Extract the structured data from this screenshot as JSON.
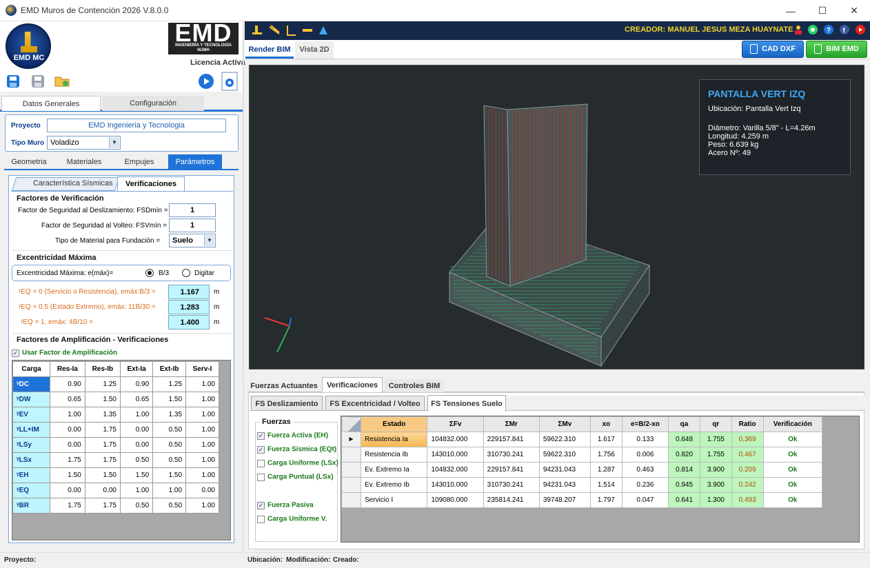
{
  "window": {
    "title": "EMD Muros de Contención 2026 V.8.0.0",
    "minimize": "—",
    "maximize": "☐",
    "close": "✕"
  },
  "logo": {
    "label": "EMD MC",
    "brand": "EMD",
    "brand_sub1": "INGENIERÍA Y TECNOLOGÍA",
    "brand_sub2": "MJMH",
    "licencia": "Licencia Activa"
  },
  "toolbar_left": {
    "icons": [
      "save-as-icon",
      "save-icon",
      "open-folder-icon",
      "play-icon",
      "preview-icon"
    ]
  },
  "main_tabs": [
    {
      "label": "Datos Generales"
    },
    {
      "label": "Configuración"
    }
  ],
  "proyecto": {
    "label": "Proyecto",
    "value": "EMD Ingenieria y Tecnologia"
  },
  "tipo_muro": {
    "label": "Tipo Muro",
    "value": "Voladizo"
  },
  "sub_tabs": [
    {
      "label": "Geometria"
    },
    {
      "label": "Materiales"
    },
    {
      "label": "Empujes"
    },
    {
      "label": "Parámetros"
    }
  ],
  "param_tabs": [
    {
      "label": "Característica Sísmicas"
    },
    {
      "label": "Verificaciones"
    }
  ],
  "factores": {
    "title": "Factores de Verificación",
    "fsd_label": "Factor de Seguridad al Deslizamiento:  FSDmín =",
    "fsd_value": "1",
    "fsv_label": "Factor de Seguridad al Volteo:  FSVmín =",
    "fsv_value": "1",
    "mat_label": "Tipo de Material para  Fundación    =",
    "mat_value": "Suelo"
  },
  "excentricidad": {
    "title": "Excentricidad Máxima",
    "label": "Excentricidad Máxima: e(máx)=",
    "opt1": "B/3",
    "opt2": "Digitar",
    "rows": [
      {
        "label": "ᵞEQ = 0 (Servicio o Resistencia), emáx:B/3 =",
        "value": "1.167",
        "unit": "m"
      },
      {
        "label": "ᵞEQ = 0.5 (Estado Extremo), emáx: 11B/30 =",
        "value": "1.283",
        "unit": "m"
      },
      {
        "label": "ᵞEQ = 1, emáx: 4B/10 =",
        "value": "1.400",
        "unit": "m"
      }
    ]
  },
  "amplificacion": {
    "title": "Factores de Amplificación - Verificaciones",
    "checkbox": "Usar Factor de Amplificación",
    "headers": [
      "Carga",
      "Res-Ia",
      "Res-Ib",
      "Ext-Ia",
      "Ext-Ib",
      "Serv-I"
    ],
    "rows": [
      [
        "ᵞDC",
        "0.90",
        "1.25",
        "0.90",
        "1.25",
        "1.00"
      ],
      [
        "ᵞDW",
        "0.65",
        "1.50",
        "0.65",
        "1.50",
        "1.00"
      ],
      [
        "ᵞEV",
        "1.00",
        "1.35",
        "1.00",
        "1.35",
        "1.00"
      ],
      [
        "ᵞLL+IM",
        "0.00",
        "1.75",
        "0.00",
        "0.50",
        "1.00"
      ],
      [
        "ᵞLSy",
        "0.00",
        "1.75",
        "0.00",
        "0.50",
        "1.00"
      ],
      [
        "ᵞLSx",
        "1.75",
        "1.75",
        "0.50",
        "0.50",
        "1.00"
      ],
      [
        "ᵞEH",
        "1.50",
        "1.50",
        "1.50",
        "1.50",
        "1.00"
      ],
      [
        "ᵞEQ",
        "0.00",
        "0.00",
        "1.00",
        "1.00",
        "0.00"
      ],
      [
        "ᵞBR",
        "1.75",
        "1.75",
        "0.50",
        "0.50",
        "1.00"
      ]
    ]
  },
  "creador": "CREADOR: MANUEL JESUS MEZA HUAYNATE",
  "view_tabs": [
    {
      "label": "Render BIM"
    },
    {
      "label": "Vista 2D"
    }
  ],
  "buttons": {
    "cad": "CAD DXF",
    "bim": "BIM EMD"
  },
  "info_panel": {
    "title": "PANTALLA VERT IZQ",
    "ubicacion": "Ubicación: Pantalla Vert Izq",
    "diametro": "Diámetro: Varilla 5/8\" - L=4.26m",
    "longitud": "Longitud: 4.259 m",
    "peso": "Peso: 6.639 kg",
    "acero": "Acero Nº: 49"
  },
  "result_tabs": [
    {
      "label": "Fuerzas Actuantes"
    },
    {
      "label": "Verificaciones"
    },
    {
      "label": "Controles BIM"
    }
  ],
  "check_tabs": [
    {
      "label": "FS Deslizamiento"
    },
    {
      "label": "FS Excentricidad / Volteo"
    },
    {
      "label": "FS Tensiones Suelo"
    }
  ],
  "fuerzas": {
    "title": "Fuerzas",
    "items": [
      {
        "label": "Fuerza Activa (EH)",
        "checked": true
      },
      {
        "label": "Fuerza Sísmica (EQt)",
        "checked": true
      },
      {
        "label": "Carga Uniforme (LSx)",
        "checked": false
      },
      {
        "label": "Carga Puntual (LSx)",
        "checked": false
      },
      {
        "label": "Fuerza Pasiva",
        "checked": true
      },
      {
        "label": "Carga Uniforme V.",
        "checked": false
      }
    ]
  },
  "results": {
    "headers": [
      "Estado",
      "ΣFv",
      "ΣMr",
      "ΣMv",
      "xo",
      "e=B/2-xo",
      "qa",
      "qr",
      "Ratio",
      "Verificación"
    ],
    "rows": [
      [
        "Resistencia Ia",
        "104832.000",
        "229157.841",
        "59622.310",
        "1.617",
        "0.133",
        "0.648",
        "1.755",
        "0.369",
        "Ok"
      ],
      [
        "Resistencia Ib",
        "143010.000",
        "310730.241",
        "59622.310",
        "1.756",
        "0.006",
        "0.820",
        "1.755",
        "0.467",
        "Ok"
      ],
      [
        "Ev. Extremo Ia",
        "104832.000",
        "229157.841",
        "94231.043",
        "1.287",
        "0.463",
        "0.814",
        "3.900",
        "0.209",
        "Ok"
      ],
      [
        "Ev. Extremo Ib",
        "143010.000",
        "310730.241",
        "94231.043",
        "1.514",
        "0.236",
        "0.945",
        "3.900",
        "0.242",
        "Ok"
      ],
      [
        "Servicio I",
        "109080.000",
        "235814.241",
        "39748.207",
        "1.797",
        "0.047",
        "0.641",
        "1.300",
        "0.493",
        "Ok"
      ]
    ]
  },
  "statusbar": {
    "proyecto": "Proyecto:",
    "ubicacion": "Ubicación:",
    "modificacion": "Modificación:",
    "creado": "Creado:"
  }
}
